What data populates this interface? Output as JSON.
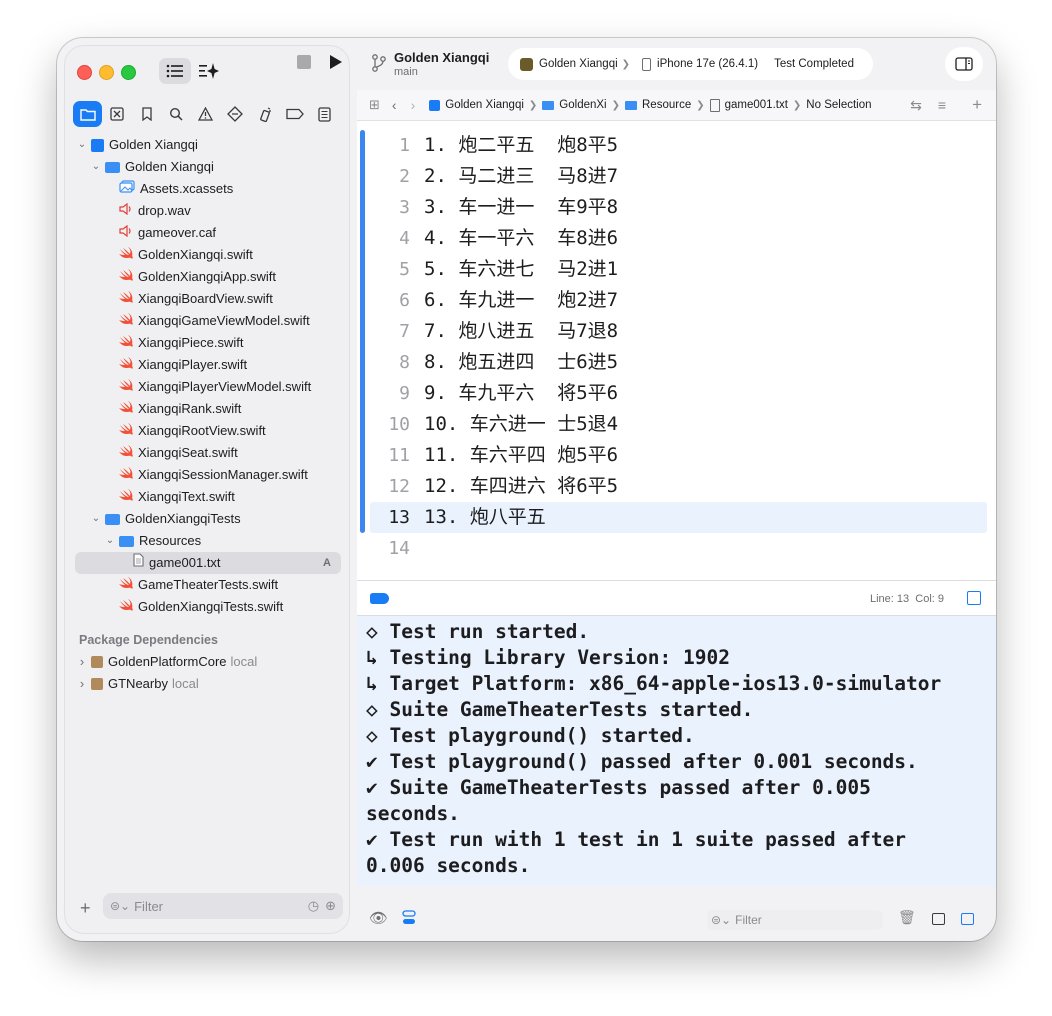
{
  "sidebar": {
    "nav_tabs": [
      "folder-icon",
      "source-control-icon",
      "bookmark-icon",
      "find-icon",
      "issues-icon",
      "tests-icon",
      "debug-icon",
      "breakpoint-icon",
      "report-icon"
    ],
    "tree": [
      {
        "label": "Golden Xiangqi",
        "icon": "project-icon",
        "chevron": "open"
      },
      {
        "label": "Golden Xiangqi",
        "icon": "folder-icon",
        "chevron": "open"
      },
      {
        "label": "Assets.xcassets",
        "icon": "assets-icon"
      },
      {
        "label": "drop.wav",
        "icon": "audio-icon"
      },
      {
        "label": "gameover.caf",
        "icon": "audio-icon"
      },
      {
        "label": "GoldenXiangqi.swift",
        "icon": "swift-icon"
      },
      {
        "label": "GoldenXiangqiApp.swift",
        "icon": "swift-icon"
      },
      {
        "label": "XiangqiBoardView.swift",
        "icon": "swift-icon"
      },
      {
        "label": "XiangqiGameViewModel.swift",
        "icon": "swift-icon"
      },
      {
        "label": "XiangqiPiece.swift",
        "icon": "swift-icon"
      },
      {
        "label": "XiangqiPlayer.swift",
        "icon": "swift-icon"
      },
      {
        "label": "XiangqiPlayerViewModel.swift",
        "icon": "swift-icon"
      },
      {
        "label": "XiangqiRank.swift",
        "icon": "swift-icon"
      },
      {
        "label": "XiangqiRootView.swift",
        "icon": "swift-icon"
      },
      {
        "label": "XiangqiSeat.swift",
        "icon": "swift-icon"
      },
      {
        "label": "XiangqiSessionManager.swift",
        "icon": "swift-icon"
      },
      {
        "label": "XiangqiText.swift",
        "icon": "swift-icon"
      },
      {
        "label": "GoldenXiangqiTests",
        "icon": "folder-icon",
        "chevron": "open"
      },
      {
        "label": "Resources",
        "icon": "folder-icon",
        "chevron": "open"
      },
      {
        "label": "game001.txt",
        "icon": "text-file-icon",
        "badge": "A",
        "selected": true
      },
      {
        "label": "GameTheaterTests.swift",
        "icon": "swift-icon"
      },
      {
        "label": "GoldenXiangqiTests.swift",
        "icon": "swift-icon"
      }
    ],
    "package_header": "Package Dependencies",
    "packages": [
      {
        "name": "GoldenPlatformCore",
        "tag": "local"
      },
      {
        "name": "GTNearby",
        "tag": "local"
      }
    ],
    "filter_placeholder": "Filter"
  },
  "toolbar": {
    "project_name": "Golden Xiangqi",
    "branch": "main",
    "scheme": "Golden Xiangqi",
    "destination": "iPhone 17e (26.4.1)",
    "status": "Test Completed"
  },
  "jumpbar": {
    "crumbs": [
      "Golden Xiangqi",
      "GoldenXi",
      "Resource",
      "game001.txt",
      "No Selection"
    ]
  },
  "editor": {
    "lines": [
      {
        "n": "1",
        "text": "1. 炮二平五  炮8平5"
      },
      {
        "n": "2",
        "text": "2. 马二进三  马8进7"
      },
      {
        "n": "3",
        "text": "3. 车一进一  车9平8"
      },
      {
        "n": "4",
        "text": "4. 车一平六  车8进6"
      },
      {
        "n": "5",
        "text": "5. 车六进七  马2进1"
      },
      {
        "n": "6",
        "text": "6. 车九进一  炮2进7"
      },
      {
        "n": "7",
        "text": "7. 炮八进五  马7退8"
      },
      {
        "n": "8",
        "text": "8. 炮五进四  士6进5"
      },
      {
        "n": "9",
        "text": "9. 车九平六  将5平6"
      },
      {
        "n": "10",
        "text": "10. 车六进一 士5退4"
      },
      {
        "n": "11",
        "text": "11. 车六平四 炮5平6"
      },
      {
        "n": "12",
        "text": "12. 车四进六 将6平5"
      },
      {
        "n": "13",
        "text": "13. 炮八平五"
      },
      {
        "n": "14",
        "text": ""
      }
    ],
    "current_line": 13
  },
  "debug_bar": {
    "position": "Line: 13  Col: 9"
  },
  "console": {
    "lines": [
      "◇ Test run started.",
      "↳ Testing Library Version: 1902",
      "↳ Target Platform: x86_64-apple-ios13.0-simulator",
      "◇ Suite GameTheaterTests started.",
      "◇ Test playground() started.",
      "✔ Test playground() passed after 0.001 seconds.",
      "✔ Suite GameTheaterTests passed after 0.005",
      "seconds.",
      "✔ Test run with 1 test in 1 suite passed after",
      "0.006 seconds."
    ],
    "filter_placeholder": "Filter"
  },
  "colors": {
    "accent": "#1a7cf5",
    "swift": "#f05138",
    "folder": "#3a8ff5",
    "console_bg": "#eaf2fd"
  }
}
